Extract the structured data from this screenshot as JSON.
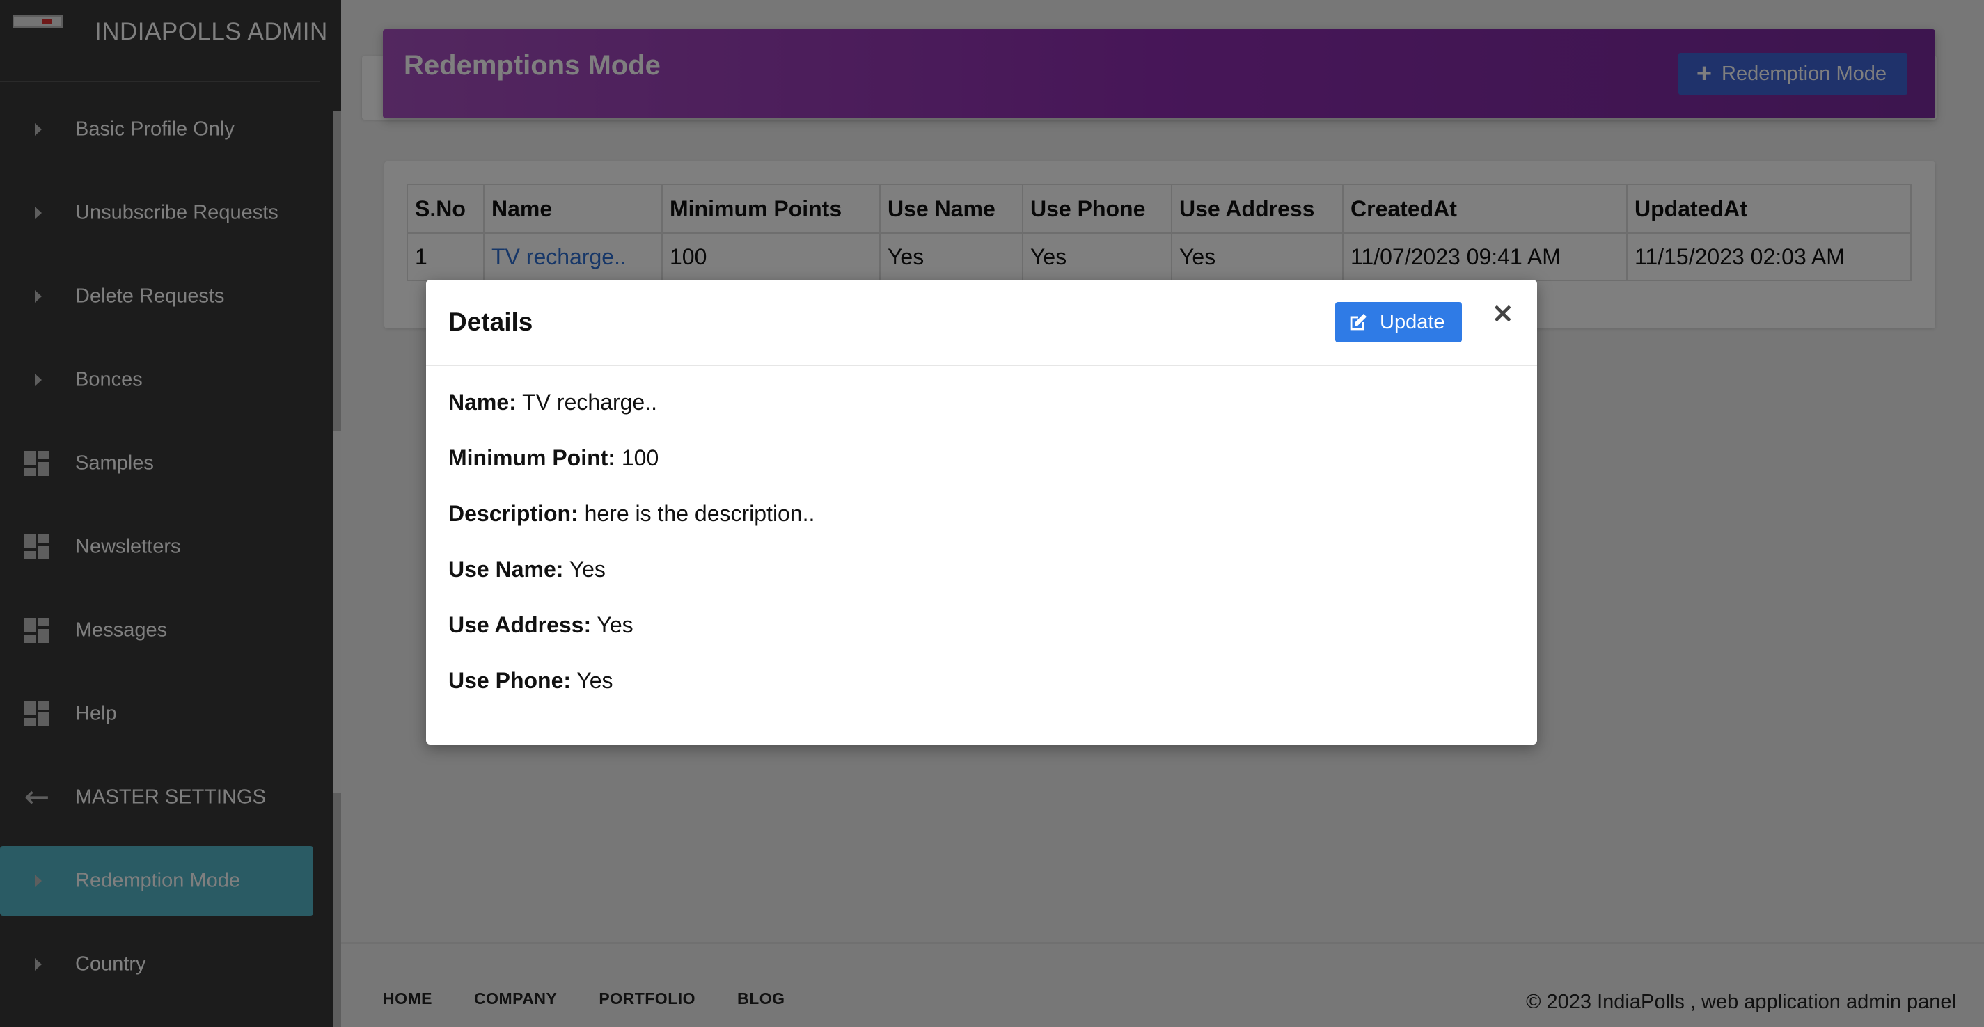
{
  "app": {
    "title": "INDIAPOLLS ADMIN"
  },
  "sidebar": {
    "items": [
      {
        "label": "Basic Profile Only",
        "icon": "caret-right-icon"
      },
      {
        "label": "Unsubscribe Requests",
        "icon": "caret-right-icon"
      },
      {
        "label": "Delete Requests",
        "icon": "caret-right-icon"
      },
      {
        "label": "Bonces",
        "icon": "caret-right-icon"
      },
      {
        "label": "Samples",
        "icon": "dashboard-icon"
      },
      {
        "label": "Newsletters",
        "icon": "dashboard-icon"
      },
      {
        "label": "Messages",
        "icon": "dashboard-icon"
      },
      {
        "label": "Help",
        "icon": "dashboard-icon"
      },
      {
        "label": "MASTER SETTINGS",
        "icon": "arrow-back-icon"
      },
      {
        "label": "Redemption Mode",
        "icon": "caret-right-icon",
        "active": true
      },
      {
        "label": "Country",
        "icon": "caret-right-icon"
      }
    ]
  },
  "header": {
    "title": "Redemptions Mode",
    "add_button": "Redemption Mode"
  },
  "table": {
    "columns": [
      "S.No",
      "Name",
      "Minimum Points",
      "Use Name",
      "Use Phone",
      "Use Address",
      "CreatedAt",
      "UpdatedAt"
    ],
    "rows": [
      [
        "1",
        "TV recharge..",
        "100",
        "Yes",
        "Yes",
        "Yes",
        "11/07/2023 09:41 AM",
        "11/15/2023 02:03 AM"
      ]
    ]
  },
  "modal": {
    "title": "Details",
    "update_button": "Update",
    "close_glyph": "×",
    "fields": [
      {
        "label": "Name:",
        "value": "TV recharge.."
      },
      {
        "label": "Minimum Point:",
        "value": "100"
      },
      {
        "label": "Description:",
        "value": "here is the description.."
      },
      {
        "label": "Use Name:",
        "value": "Yes"
      },
      {
        "label": "Use Address:",
        "value": "Yes"
      },
      {
        "label": "Use Phone:",
        "value": "Yes"
      }
    ]
  },
  "footer": {
    "links": [
      "HOME",
      "COMPANY",
      "PORTFOLIO",
      "BLOG"
    ],
    "copyright": "© 2023 IndiaPolls , web application admin panel"
  },
  "colors": {
    "sidebar_bg": "#383838",
    "active_item": "#54b6c9",
    "banner": "#8e2db0",
    "primary_button": "#3f64d6",
    "update_button": "#2f7be6",
    "link": "#2f6fd0"
  }
}
